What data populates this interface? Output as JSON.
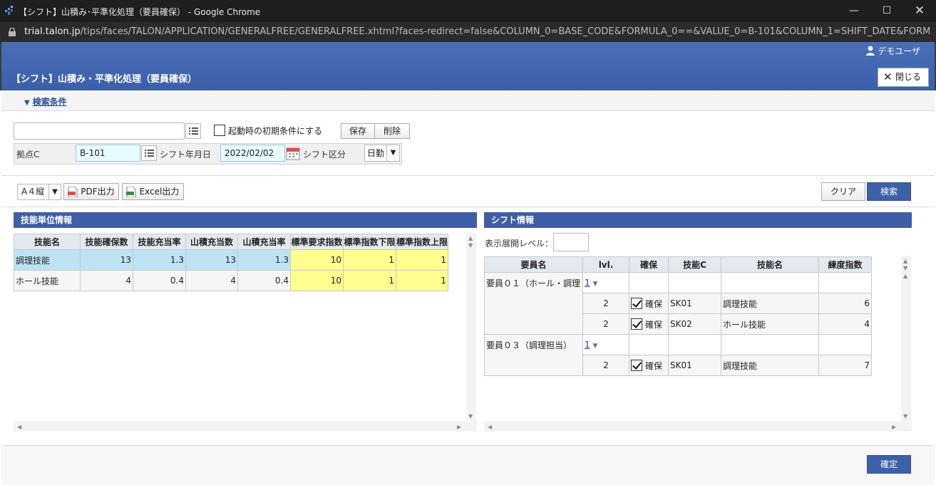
{
  "window": {
    "title": "【シフト】山積み･平準化処理（要員確保） - Google Chrome",
    "url_host": "trial.talon.jp",
    "url_path": "/tips/faces/TALON/APPLICATION/GENERALFREE/GENERALFREE.xhtml?faces-redirect=false&COLUMN_0=BASE_CODE&FORMULA_0==&VALUE_0=B-101&COLUMN_1=SHIFT_DATE&FORMUL..."
  },
  "header": {
    "user": "デモユーザ",
    "page_title": "【シフト】山積み・平準化処理（要員確保）",
    "close_label": "閉じる"
  },
  "conditions": {
    "toggle_label": "検索条件",
    "preset_value": "",
    "startup_checkbox_label": "起動時の初期条件にする",
    "save_label": "保存",
    "delete_label": "削除",
    "base_label": "拠点C",
    "base_value": "B-101",
    "shift_date_label": "シフト年月日",
    "shift_date_value": "2022/02/02",
    "shift_type_label": "シフト区分",
    "shift_type_value": "日勤"
  },
  "toolbar": {
    "paper_value": "A４縦",
    "pdf_label": "PDF出力",
    "excel_label": "Excel出力",
    "clear_label": "クリア",
    "search_label": "検索"
  },
  "skill_panel": {
    "title": "技能単位情報",
    "columns": [
      "技能名",
      "技能確保数",
      "技能充当率",
      "山積充当数",
      "山積充当率",
      "標準要求指数",
      "標準指数下限",
      "標準指数上限"
    ],
    "rows": [
      [
        "調理技能",
        "13",
        "1.3",
        "13",
        "1.3",
        "10",
        "1",
        "1"
      ],
      [
        "ホール技能",
        "4",
        "0.4",
        "4",
        "0.4",
        "10",
        "1",
        "1"
      ]
    ]
  },
  "shift_panel": {
    "title": "シフト情報",
    "level_label": "表示展開レベル：",
    "level_value": "",
    "columns": [
      "要員名",
      "lvl.",
      "確保",
      "技能C",
      "技能名",
      "練度指数"
    ],
    "groups": [
      {
        "name": "要員０１（ホール・調理",
        "lvl": "1",
        "rows": [
          {
            "lvl": "2",
            "secure": "確保",
            "code": "SK01",
            "skill": "調理技能",
            "score": "6"
          },
          {
            "lvl": "2",
            "secure": "確保",
            "code": "SK02",
            "skill": "ホール技能",
            "score": "4"
          }
        ]
      },
      {
        "name": "要員０３（調理担当）",
        "lvl": "1",
        "rows": [
          {
            "lvl": "2",
            "secure": "確保",
            "code": "SK01",
            "skill": "調理技能",
            "score": "7"
          }
        ]
      }
    ]
  },
  "footer": {
    "confirm_label": "確定"
  },
  "colors": {
    "header_blue": "#3f62ab",
    "row_highlight": "#bde3f5",
    "yellow_cell": "#ffff8f"
  }
}
